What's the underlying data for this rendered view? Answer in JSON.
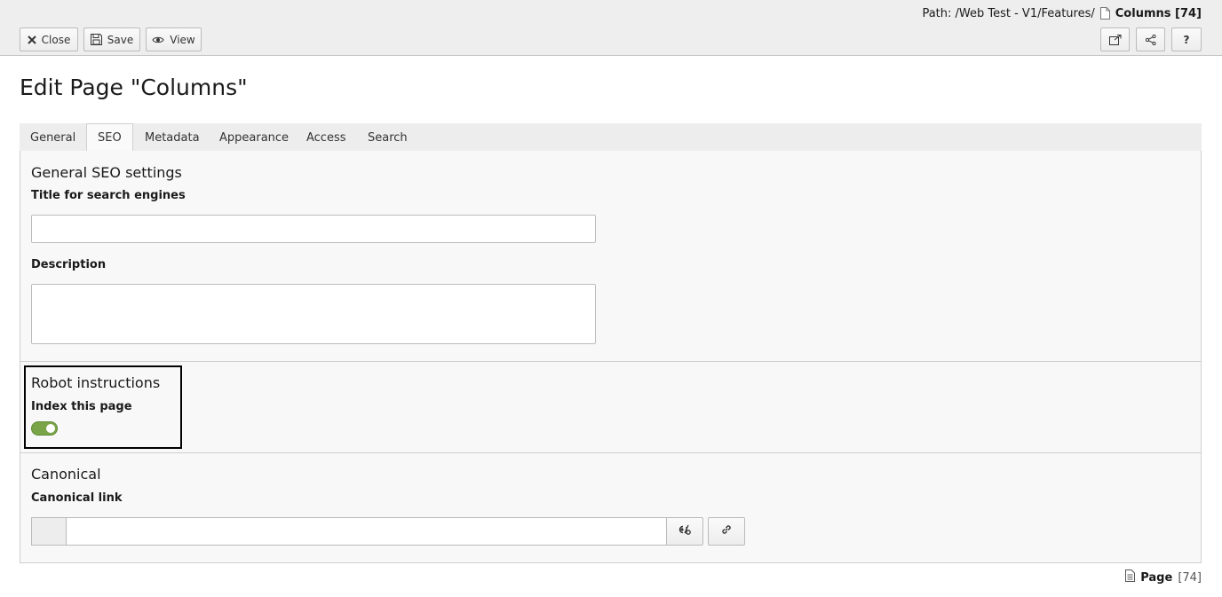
{
  "docheader": {
    "path_prefix": "Path: /Web Test - V1/Features/",
    "path_current": "Columns [74]",
    "buttons": {
      "close": "Close",
      "save": "Save",
      "view": "View",
      "help": "?"
    }
  },
  "page_title": "Edit Page \"Columns\"",
  "tabs": [
    {
      "label": "General"
    },
    {
      "label": "SEO"
    },
    {
      "label": "Metadata"
    },
    {
      "label": "Appearance"
    },
    {
      "label": "Access"
    },
    {
      "label": "Search"
    }
  ],
  "active_tab": "SEO",
  "seo": {
    "general_heading": "General SEO settings",
    "title_label": "Title for search engines",
    "title_value": "",
    "description_label": "Description",
    "description_value": "",
    "robot_heading": "Robot instructions",
    "index_label": "Index this page",
    "index_enabled": true,
    "canonical_heading": "Canonical",
    "canonical_label": "Canonical link",
    "canonical_value": ""
  },
  "footer": {
    "type": "Page",
    "id": "[74]"
  },
  "colors": {
    "toggle_on": "#79a548",
    "tab_bar": "#ededed",
    "panel_bg": "#f8f8f8"
  }
}
